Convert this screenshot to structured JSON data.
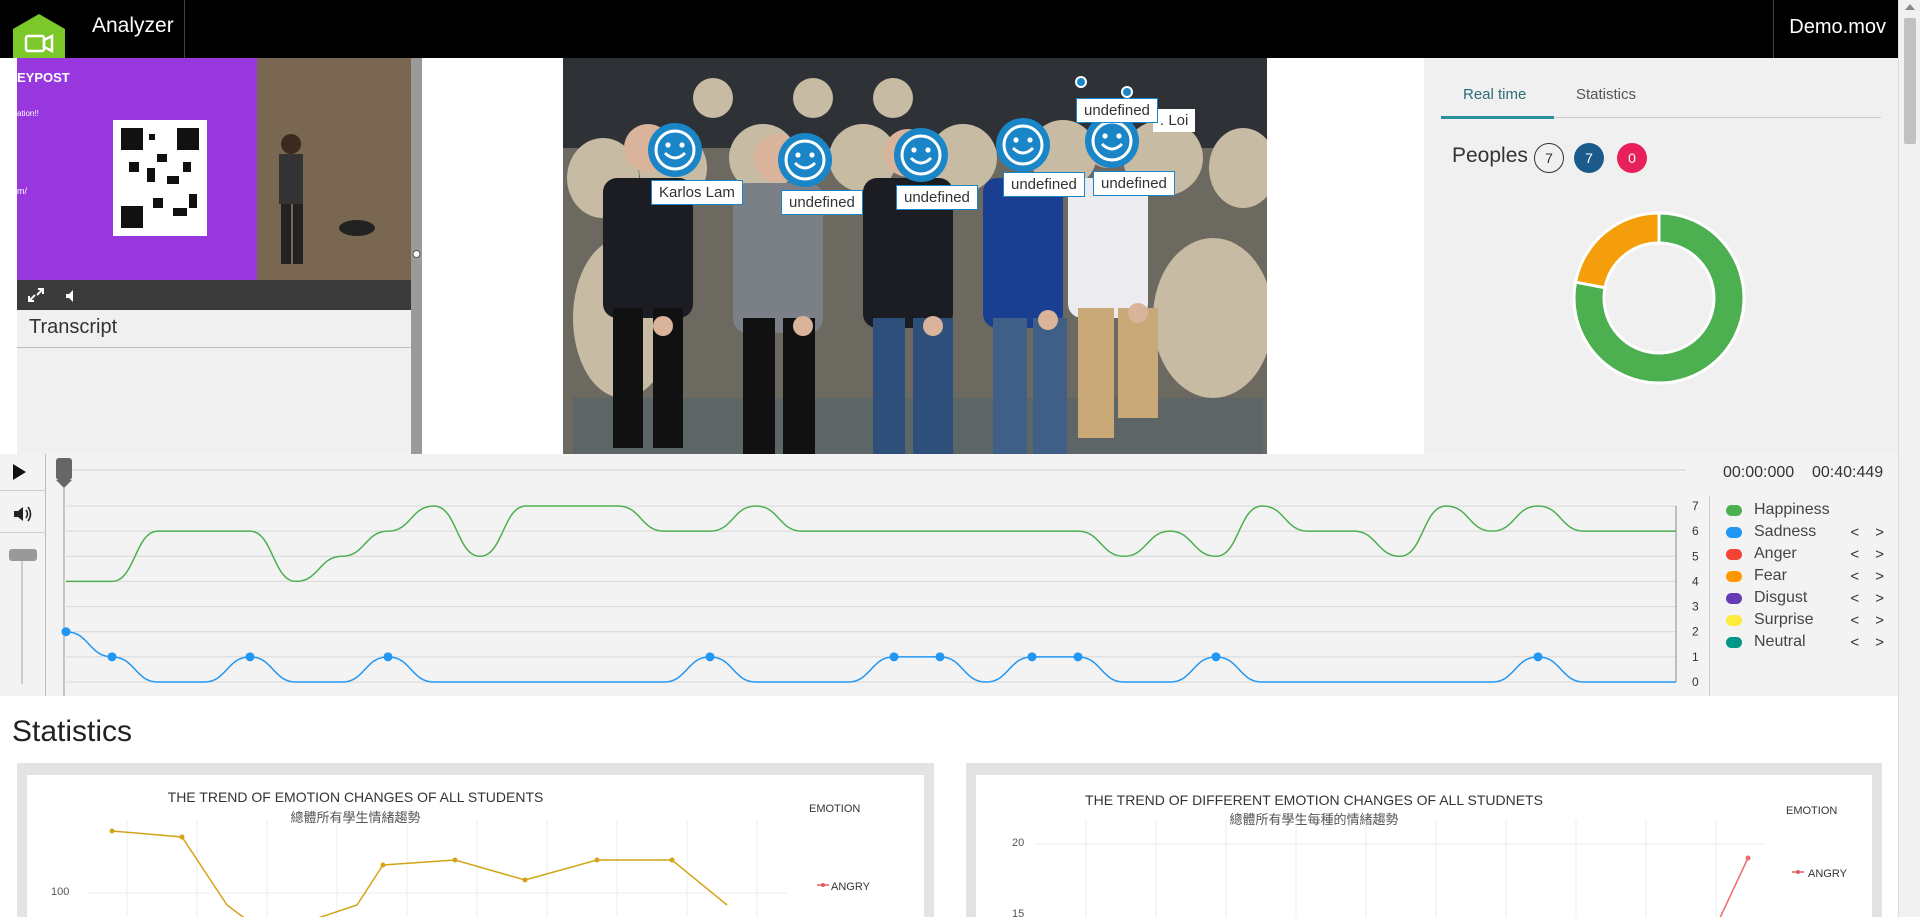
{
  "header": {
    "app_title": "Analyzer",
    "file_name": "Demo.mov"
  },
  "left_panel": {
    "transcript_title": "Transcript"
  },
  "faces": [
    {
      "label": "Karlos Lam"
    },
    {
      "label": "undefined"
    },
    {
      "label": "undefined"
    },
    {
      "label": "undefined"
    },
    {
      "label": "undefined"
    },
    {
      "label": "undefined"
    },
    {
      "label": ". Loi"
    }
  ],
  "right_panel": {
    "tabs": [
      "Real time",
      "Statistics"
    ],
    "active_tab": "Real time",
    "peoples_label": "Peoples",
    "counts": {
      "total": "7",
      "detected": "7",
      "alert": "0"
    },
    "donut": [
      {
        "name": "Happiness",
        "value": 78,
        "color": "#4caf50"
      },
      {
        "name": "Fear",
        "value": 22,
        "color": "#f59e0b"
      }
    ]
  },
  "timeline": {
    "time_start": "00:00:000",
    "time_end": "00:40:449",
    "y_ticks": [
      "7",
      "6",
      "5",
      "4",
      "3",
      "2",
      "1",
      "0"
    ],
    "legend": [
      {
        "name": "Happiness",
        "color": "#4caf50",
        "nav": false
      },
      {
        "name": "Sadness",
        "color": "#2196f3",
        "nav": true
      },
      {
        "name": "Anger",
        "color": "#f44336",
        "nav": true
      },
      {
        "name": "Fear",
        "color": "#ff9800",
        "nav": true
      },
      {
        "name": "Disgust",
        "color": "#673ab7",
        "nav": true
      },
      {
        "name": "Surprise",
        "color": "#ffeb3b",
        "nav": true
      },
      {
        "name": "Neutral",
        "color": "#009688",
        "nav": true
      }
    ],
    "nav_symbols": "< >"
  },
  "chart_data": [
    {
      "type": "line",
      "title": "",
      "y_range": [
        0,
        7
      ],
      "series": [
        {
          "name": "Happiness",
          "values": [
            4,
            4,
            6,
            6,
            6,
            4,
            5,
            6,
            7,
            5,
            7,
            7,
            7,
            6,
            6,
            7,
            6,
            6,
            6,
            6,
            6,
            6,
            6,
            5,
            6,
            5,
            7,
            6,
            6,
            5,
            7,
            6,
            7,
            6,
            6,
            6
          ]
        },
        {
          "name": "Sadness",
          "values": [
            2,
            1,
            0,
            0,
            1,
            0,
            0,
            1,
            0,
            0,
            0,
            0,
            0,
            0,
            1,
            0,
            0,
            0,
            1,
            1,
            0,
            1,
            1,
            0,
            0,
            1,
            0,
            0,
            0,
            0,
            0,
            0,
            1,
            0,
            0,
            0
          ]
        }
      ]
    }
  ],
  "statistics": {
    "section_title": "Statistics",
    "card1": {
      "title": "THE TREND OF EMOTION CHANGES OF ALL STUDENTS",
      "subtitle": "總體所有學生情緒趨勢",
      "legend_title": "EMOTION",
      "legend_first": "ANGRY",
      "y_tick": "100"
    },
    "card2": {
      "title": "THE TREND OF DIFFERENT EMOTION CHANGES OF ALL STUDNETS",
      "subtitle": "總體所有學生每種的情緒趨勢",
      "legend_title": "EMOTION",
      "legend_first": "ANGRY",
      "y_tick_a": "20",
      "y_tick_b": "15"
    }
  }
}
